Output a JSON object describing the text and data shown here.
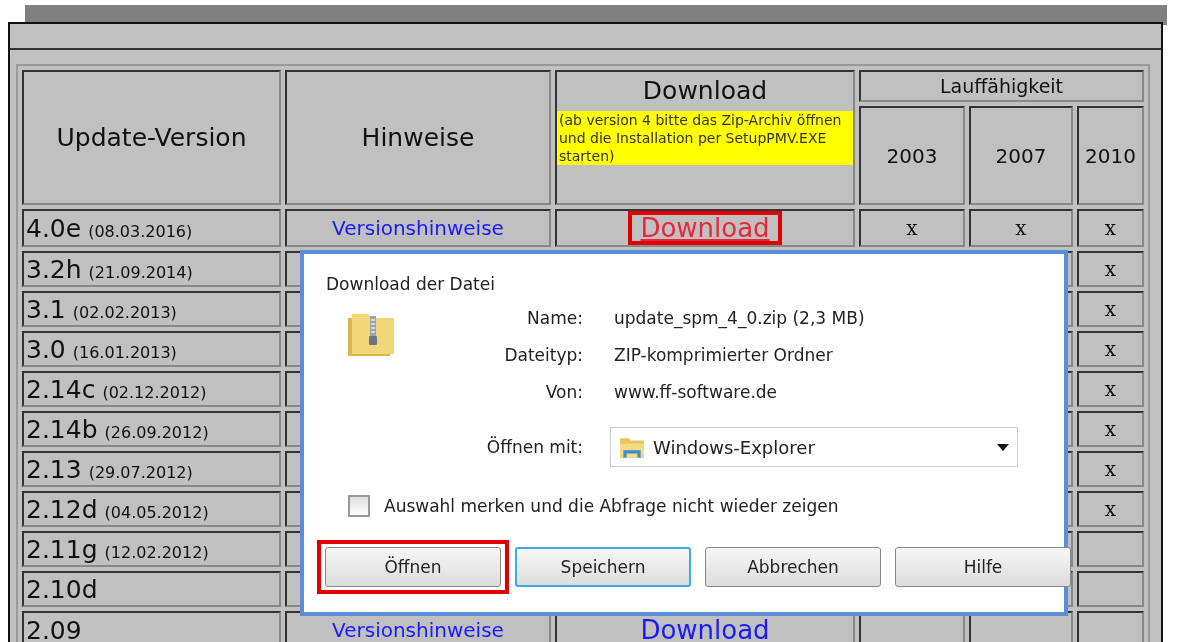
{
  "table": {
    "columns": {
      "version": "Update-Version",
      "notes": "Hinweise",
      "download": "Download",
      "download_note": "(ab version 4 bitte das Zip-Archiv öffnen und die Installation per SetupPMV.EXE starten)",
      "compat": "Lauffähigkeit",
      "years": [
        "2003",
        "2007",
        "2010"
      ]
    },
    "rows": [
      {
        "version": "4.0e",
        "date": "(08.03.2016)",
        "notes": "Versionshinweise",
        "download": "Download",
        "highlighted": true,
        "mark_2003": "x",
        "mark_2007": "x",
        "mark_2010": "x"
      },
      {
        "version": "3.2h",
        "date": "(21.09.2014)",
        "mark_2010": "x"
      },
      {
        "version": "3.1",
        "date": "(02.02.2013)",
        "mark_2010": "x"
      },
      {
        "version": "3.0",
        "date": "(16.01.2013)",
        "mark_2010": "x"
      },
      {
        "version": "2.14c",
        "date": "(02.12.2012)",
        "mark_2010": "x"
      },
      {
        "version": "2.14b",
        "date": "(26.09.2012)",
        "mark_2010": "x"
      },
      {
        "version": "2.13",
        "date": "(29.07.2012)",
        "mark_2010": "x"
      },
      {
        "version": "2.12d",
        "date": "(04.05.2012)",
        "mark_2010": "x"
      },
      {
        "version": "2.11g",
        "date": "(12.02.2012)"
      },
      {
        "version": "2.10d"
      },
      {
        "version": "2.09",
        "notes": "Versionshinweise",
        "download": "Download",
        "highlighted": false
      }
    ]
  },
  "dialog": {
    "title": "Download der Datei",
    "fields": [
      {
        "label": "Name:",
        "value": "update_spm_4_0.zip (2,3 MB)"
      },
      {
        "label": "Dateityp:",
        "value": "ZIP-komprimierter Ordner"
      },
      {
        "label": "Von:",
        "value": "www.ff-software.de"
      }
    ],
    "open_with": {
      "label": "Öffnen mit:",
      "value": "Windows-Explorer"
    },
    "remember": {
      "label": "Auswahl merken und die Abfrage nicht wieder zeigen",
      "checked": false
    },
    "buttons": [
      {
        "label": "Öffnen",
        "highlighted": true,
        "default": false
      },
      {
        "label": "Speichern",
        "highlighted": false,
        "default": true
      },
      {
        "label": "Abbrechen",
        "highlighted": false,
        "default": false
      },
      {
        "label": "Hilfe",
        "highlighted": false,
        "default": false
      }
    ]
  }
}
